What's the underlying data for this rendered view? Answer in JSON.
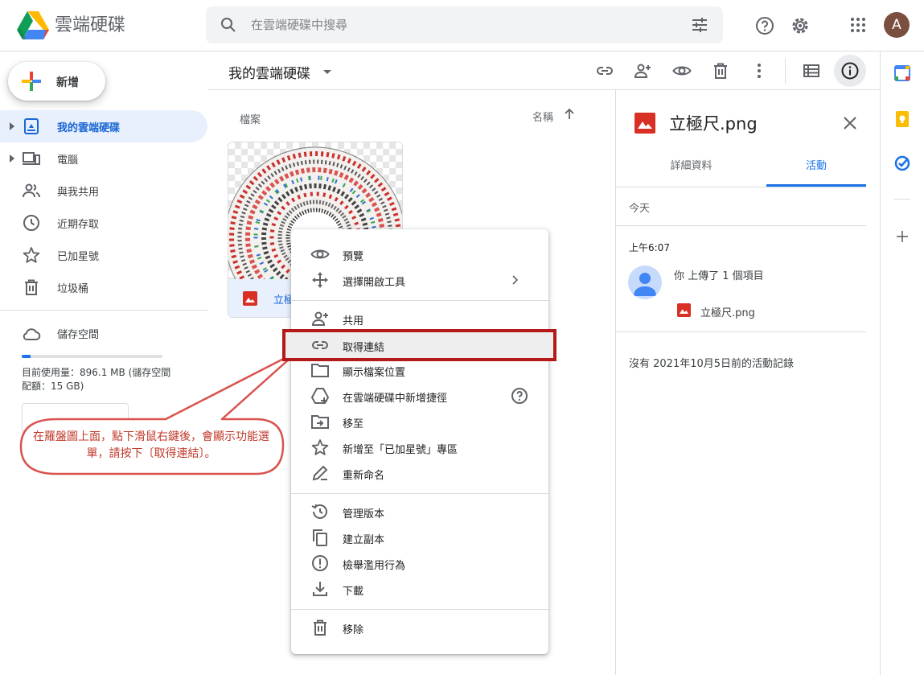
{
  "header": {
    "app_title": "雲端硬碟",
    "search_placeholder": "在雲端硬碟中搜尋",
    "avatar_letter": "A"
  },
  "sidebar": {
    "new_label": "新增",
    "items": [
      {
        "label": "我的雲端硬碟",
        "icon": "my-drive-icon",
        "active": true
      },
      {
        "label": "電腦",
        "icon": "computer-icon"
      },
      {
        "label": "與我共用",
        "icon": "shared-icon"
      },
      {
        "label": "近期存取",
        "icon": "clock-icon"
      },
      {
        "label": "已加星號",
        "icon": "star-icon"
      },
      {
        "label": "垃圾桶",
        "icon": "trash-icon"
      }
    ],
    "storage": {
      "label": "儲存空間",
      "usage_text": "目前使用量：896.1 MB (儲存空間配額：15 GB)",
      "used_fraction": 0.06
    }
  },
  "toolbar": {
    "breadcrumb": "我的雲端硬碟"
  },
  "files": {
    "section_label": "檔案",
    "sort_label": "名稱",
    "file_name": "立極尺.png",
    "caption_visible": "立極"
  },
  "details": {
    "title": "立極尺.png",
    "tabs": [
      "詳細資料",
      "活動"
    ],
    "today_label": "今天",
    "time": "上午6:07",
    "activity_text": "你 上傳了 1 個項目",
    "activity_file": "立極尺.png",
    "no_activity": "沒有 2021年10月5日前的活動記錄"
  },
  "context_menu": {
    "items": [
      {
        "label": "預覽",
        "icon": "eye-icon"
      },
      {
        "label": "選擇開啟工具",
        "icon": "move-icon"
      },
      {
        "label": "共用",
        "icon": "person-add-icon"
      },
      {
        "label": "取得連結",
        "icon": "link-icon"
      },
      {
        "label": "顯示檔案位置",
        "icon": "folder-icon"
      },
      {
        "label": "在雲端硬碟中新增捷徑",
        "icon": "shortcut-icon"
      },
      {
        "label": "移至",
        "icon": "move-to-icon"
      },
      {
        "label": "新增至「已加星號」專區",
        "icon": "star-icon"
      },
      {
        "label": "重新命名",
        "icon": "pencil-icon"
      },
      {
        "label": "管理版本",
        "icon": "history-icon"
      },
      {
        "label": "建立副本",
        "icon": "copy-icon"
      },
      {
        "label": "檢舉濫用行為",
        "icon": "report-icon"
      },
      {
        "label": "下載",
        "icon": "download-icon"
      },
      {
        "label": "移除",
        "icon": "trash-icon"
      }
    ]
  },
  "callout": {
    "text": "在羅盤圖上面，點下滑鼠右鍵後，會顯示功能選單，請按下〔取得連結〕。"
  },
  "colors": {
    "accent": "#1a73e8",
    "active_bg": "#e8f0fe",
    "highlight_border": "#b51a1a",
    "callout_text": "#c0392b"
  }
}
